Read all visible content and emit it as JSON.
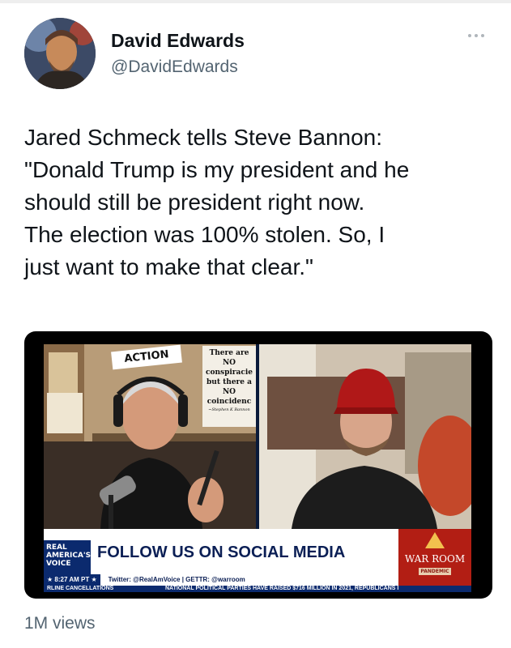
{
  "tweet": {
    "author": {
      "name": "David Edwards",
      "handle": "@DavidEdwards"
    },
    "text_lines": [
      "Jared Schmeck tells Steve Bannon:",
      "\"Donald Trump is my president and he",
      "should still be president right now.",
      "The election was 100% stolen. So, I",
      "just want to make that clear.\""
    ],
    "views": "1M views"
  },
  "video": {
    "sign_action": "ACTION",
    "sign_conspiracy_lines": [
      "There are",
      "NO",
      "conspiracie",
      "but there a",
      "NO",
      "coincidenc"
    ],
    "sign_conspiracy_credit": "~Stephen K Bannon",
    "logo_lines": [
      "REAL",
      "AMERICA'S",
      "VOICE"
    ],
    "lower_third": "FOLLOW US ON SOCIAL MEDIA",
    "time": "★ 8:27 AM PT ★",
    "social_line": "Twitter: @RealAmVoice | GETTR: @warroom",
    "crawl_left": "RLINE CANCELLATIONS",
    "crawl_right": "NATIONAL POLITICAL PARTIES HAVE RAISED $716 MILLION IN 2021, REPUBLICANS I",
    "warroom_title": "WAR ROOM",
    "warroom_sub": "PANDEMIC"
  },
  "colors": {
    "text_primary": "#0f1419",
    "text_secondary": "#536471",
    "ticker_navy": "#0b2a6e",
    "warroom_red": "#b21e14"
  },
  "icons": {
    "more": "more-dots-icon"
  }
}
